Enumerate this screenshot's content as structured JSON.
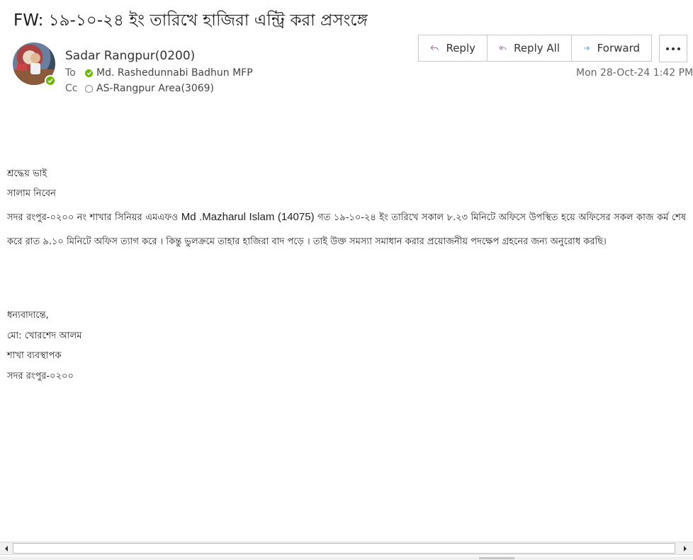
{
  "email": {
    "subject": "FW: ১৯-১০-২৪ ইং তারিখে হাজিরা এন্ট্রি করা প্রসংঙ্গে",
    "sender": "Sadar Rangpur(0200)",
    "to_label": "To",
    "to": "Md. Rashedunnabi Badhun MFP",
    "cc_label": "Cc",
    "cc": "AS-Rangpur Area(3069)",
    "date": "Mon 28-Oct-24 1:42 PM"
  },
  "actions": {
    "reply": "Reply",
    "reply_all": "Reply All",
    "forward": "Forward"
  },
  "body": {
    "greeting1": "শ্রদ্ধেয় ভাই",
    "greeting2": "সালাম নিবেন",
    "para_start": "সদর রংপুর-০২০০ নং শাখার সিনিয়র এমএফও ",
    "para_name": "Md .Mazharul Islam (14075)",
    "para_end": " গত ১৯-১০-২৪ ইং তারিখে সকাল ৮.২৩ মিনিটে অফিসে উপস্থিত হয়ে অফিসের সকল কাজ কর্ম শেষ করে রাত ৯.১০ মিনিটে অফিস ত্যাগ করে । কিন্তু ভুলক্রমে তাহার হাজিরা বাদ পড়ে । তাই উক্ত সমস্যা সমাধান করার প্রয়োজনীয় পদক্ষেপ গ্রহনের জন্য অনুরোধ করছি।",
    "sign1": "ধন্যবাদান্তে,",
    "sign2": "মো: খোরশেদ আলম",
    "sign3": "শাখা ব্যবস্থাপক",
    "sign4": "সদর রংপুর-০২০০"
  },
  "colors": {
    "reply_purple": "#9b59b6",
    "forward_blue": "#2b79d9",
    "presence_green": "#6bb700"
  }
}
